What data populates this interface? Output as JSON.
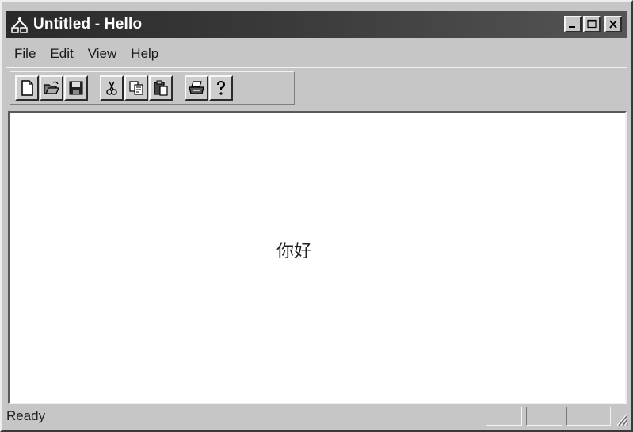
{
  "window": {
    "title": "Untitled - Hello",
    "icon": "app-document-icon",
    "caption_buttons": [
      "minimize-icon",
      "maximize-icon",
      "close-icon"
    ]
  },
  "menu": [
    {
      "accel": "F",
      "rest": "ile"
    },
    {
      "accel": "E",
      "rest": "dit"
    },
    {
      "accel": "V",
      "rest": "iew"
    },
    {
      "accel": "H",
      "rest": "elp"
    }
  ],
  "toolbar": {
    "buttons": [
      "new-icon",
      "open-icon",
      "save-icon",
      "cut-icon",
      "copy-icon",
      "paste-icon",
      "print-icon",
      "help-icon"
    ]
  },
  "client": {
    "text": "你好"
  },
  "statusbar": {
    "text": "Ready",
    "panes": 3
  }
}
